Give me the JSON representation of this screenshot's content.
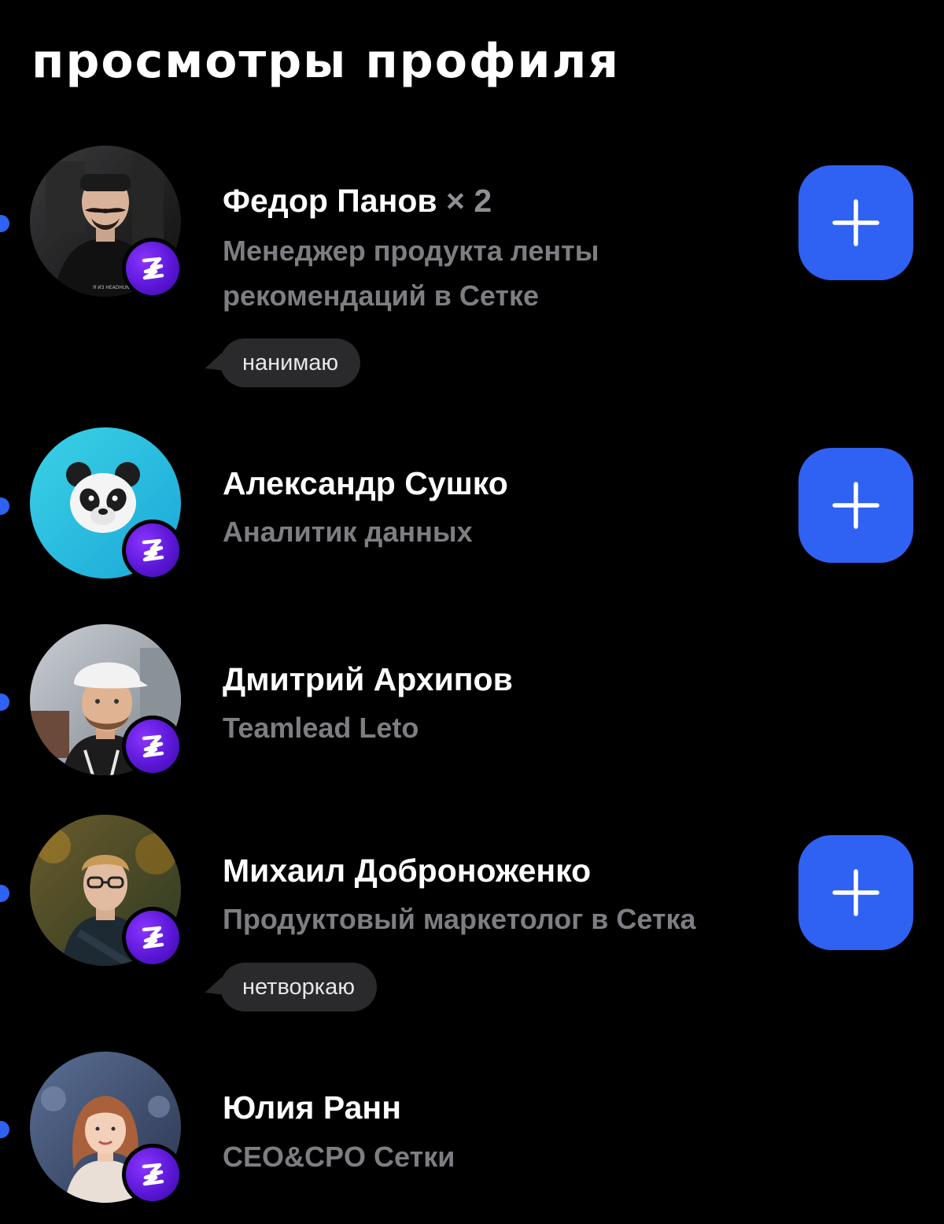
{
  "header": {
    "title": "просмотры профиля"
  },
  "viewers": [
    {
      "name": "Федор Панов",
      "count": "× 2",
      "role": "Менеджер продукта ленты рекомендаций в Сетке",
      "tag": "нанимаю",
      "has_add_button": true,
      "unread": true,
      "avatar_text": "Я ИЗ HEADHUNT"
    },
    {
      "name": "Александр Сушко",
      "role": "Аналитик данных",
      "has_add_button": true,
      "unread": true,
      "avatar_emoji": "🐼"
    },
    {
      "name": "Дмитрий Архипов",
      "role": "Teamlead Leto",
      "has_add_button": false,
      "unread": true
    },
    {
      "name": "Михаил Доброноженко",
      "role": "Продуктовый маркетолог в Сетка",
      "tag": "нетворкаю",
      "has_add_button": true,
      "unread": true
    },
    {
      "name": "Юлия Ранн",
      "role": "CEO&CPO Сетки",
      "has_add_button": false,
      "unread": true
    }
  ],
  "colors": {
    "background": "#000000",
    "accent": "#2f62f2",
    "badge": "#6a1fe8",
    "secondary_text": "#7d7d82",
    "tag_bg": "#2a2a2c"
  },
  "icons": {
    "add": "plus-icon",
    "badge": "setka-logo-icon"
  }
}
